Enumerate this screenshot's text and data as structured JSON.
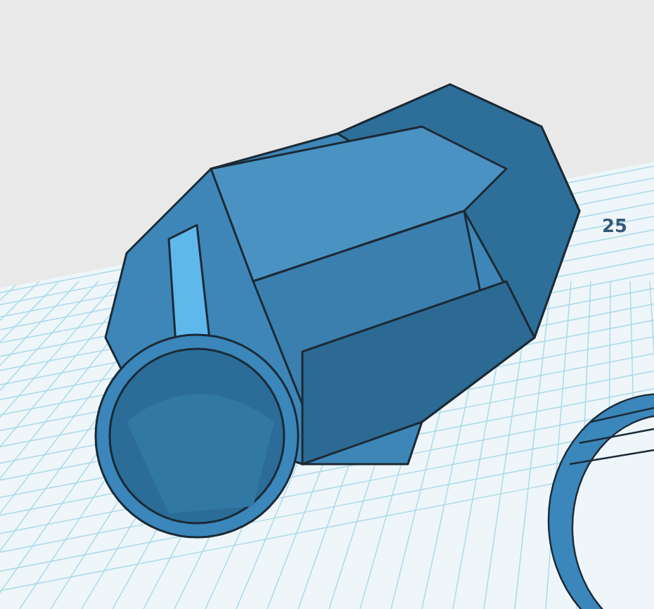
{
  "viewport": {
    "ruler_label": "25"
  }
}
